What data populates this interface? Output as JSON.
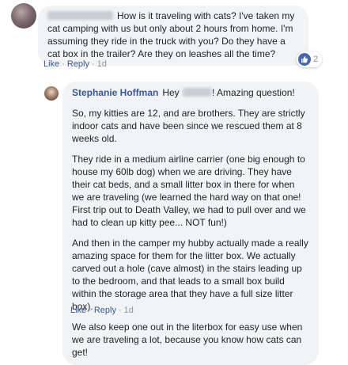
{
  "comment": {
    "text": "How is it traveling with cats? I've taken my cat camping with us but only about 2 hours from home. I'm assuming they ride in the truck with you? Do they have a cat box in the trailer? Are they on leashes all the time?",
    "actions": {
      "like": "Like",
      "reply": "Reply",
      "time": "1d"
    },
    "reaction_count": "2"
  },
  "reply": {
    "author": "Stephanie Hoffman",
    "greeting_before": "Hey",
    "greeting_after": "! Amazing question!",
    "paragraphs": [
      "So, my kitties are 12, and are brothers. They are strictly indoor cats and have been since we rescued them at 8 weeks old.",
      "They ride in a medium airline carrier (one big enough to house my 60lb dog) when we are driving. They have their cat beds, and a small litter box in there for when we are traveling (we learned the hard way on that one! First trip out to Death Valley, we had to pull over and we had to clean up kitty pee... NOT fun!)",
      "And then in the camper my hubby actually made a really amazing space for them for the litter box. We actually carved out a hole (cave almost) in the stairs leading up to the bedroom, and that leads to a small box build within the storage area that they have a full size litter box).",
      "We also keep one out in the literbox for easy use when we are traveling a lot, because you know how cats can get!"
    ],
    "actions": {
      "like": "Like",
      "reply": "Reply",
      "time": "1d"
    }
  },
  "colors": {
    "bubble": "#f2f3f5",
    "link": "#385898",
    "meta": "#90949c",
    "text": "#1d2129",
    "like_badge": "#4267b2"
  },
  "icons": {
    "reaction": "like-thumb-icon"
  }
}
